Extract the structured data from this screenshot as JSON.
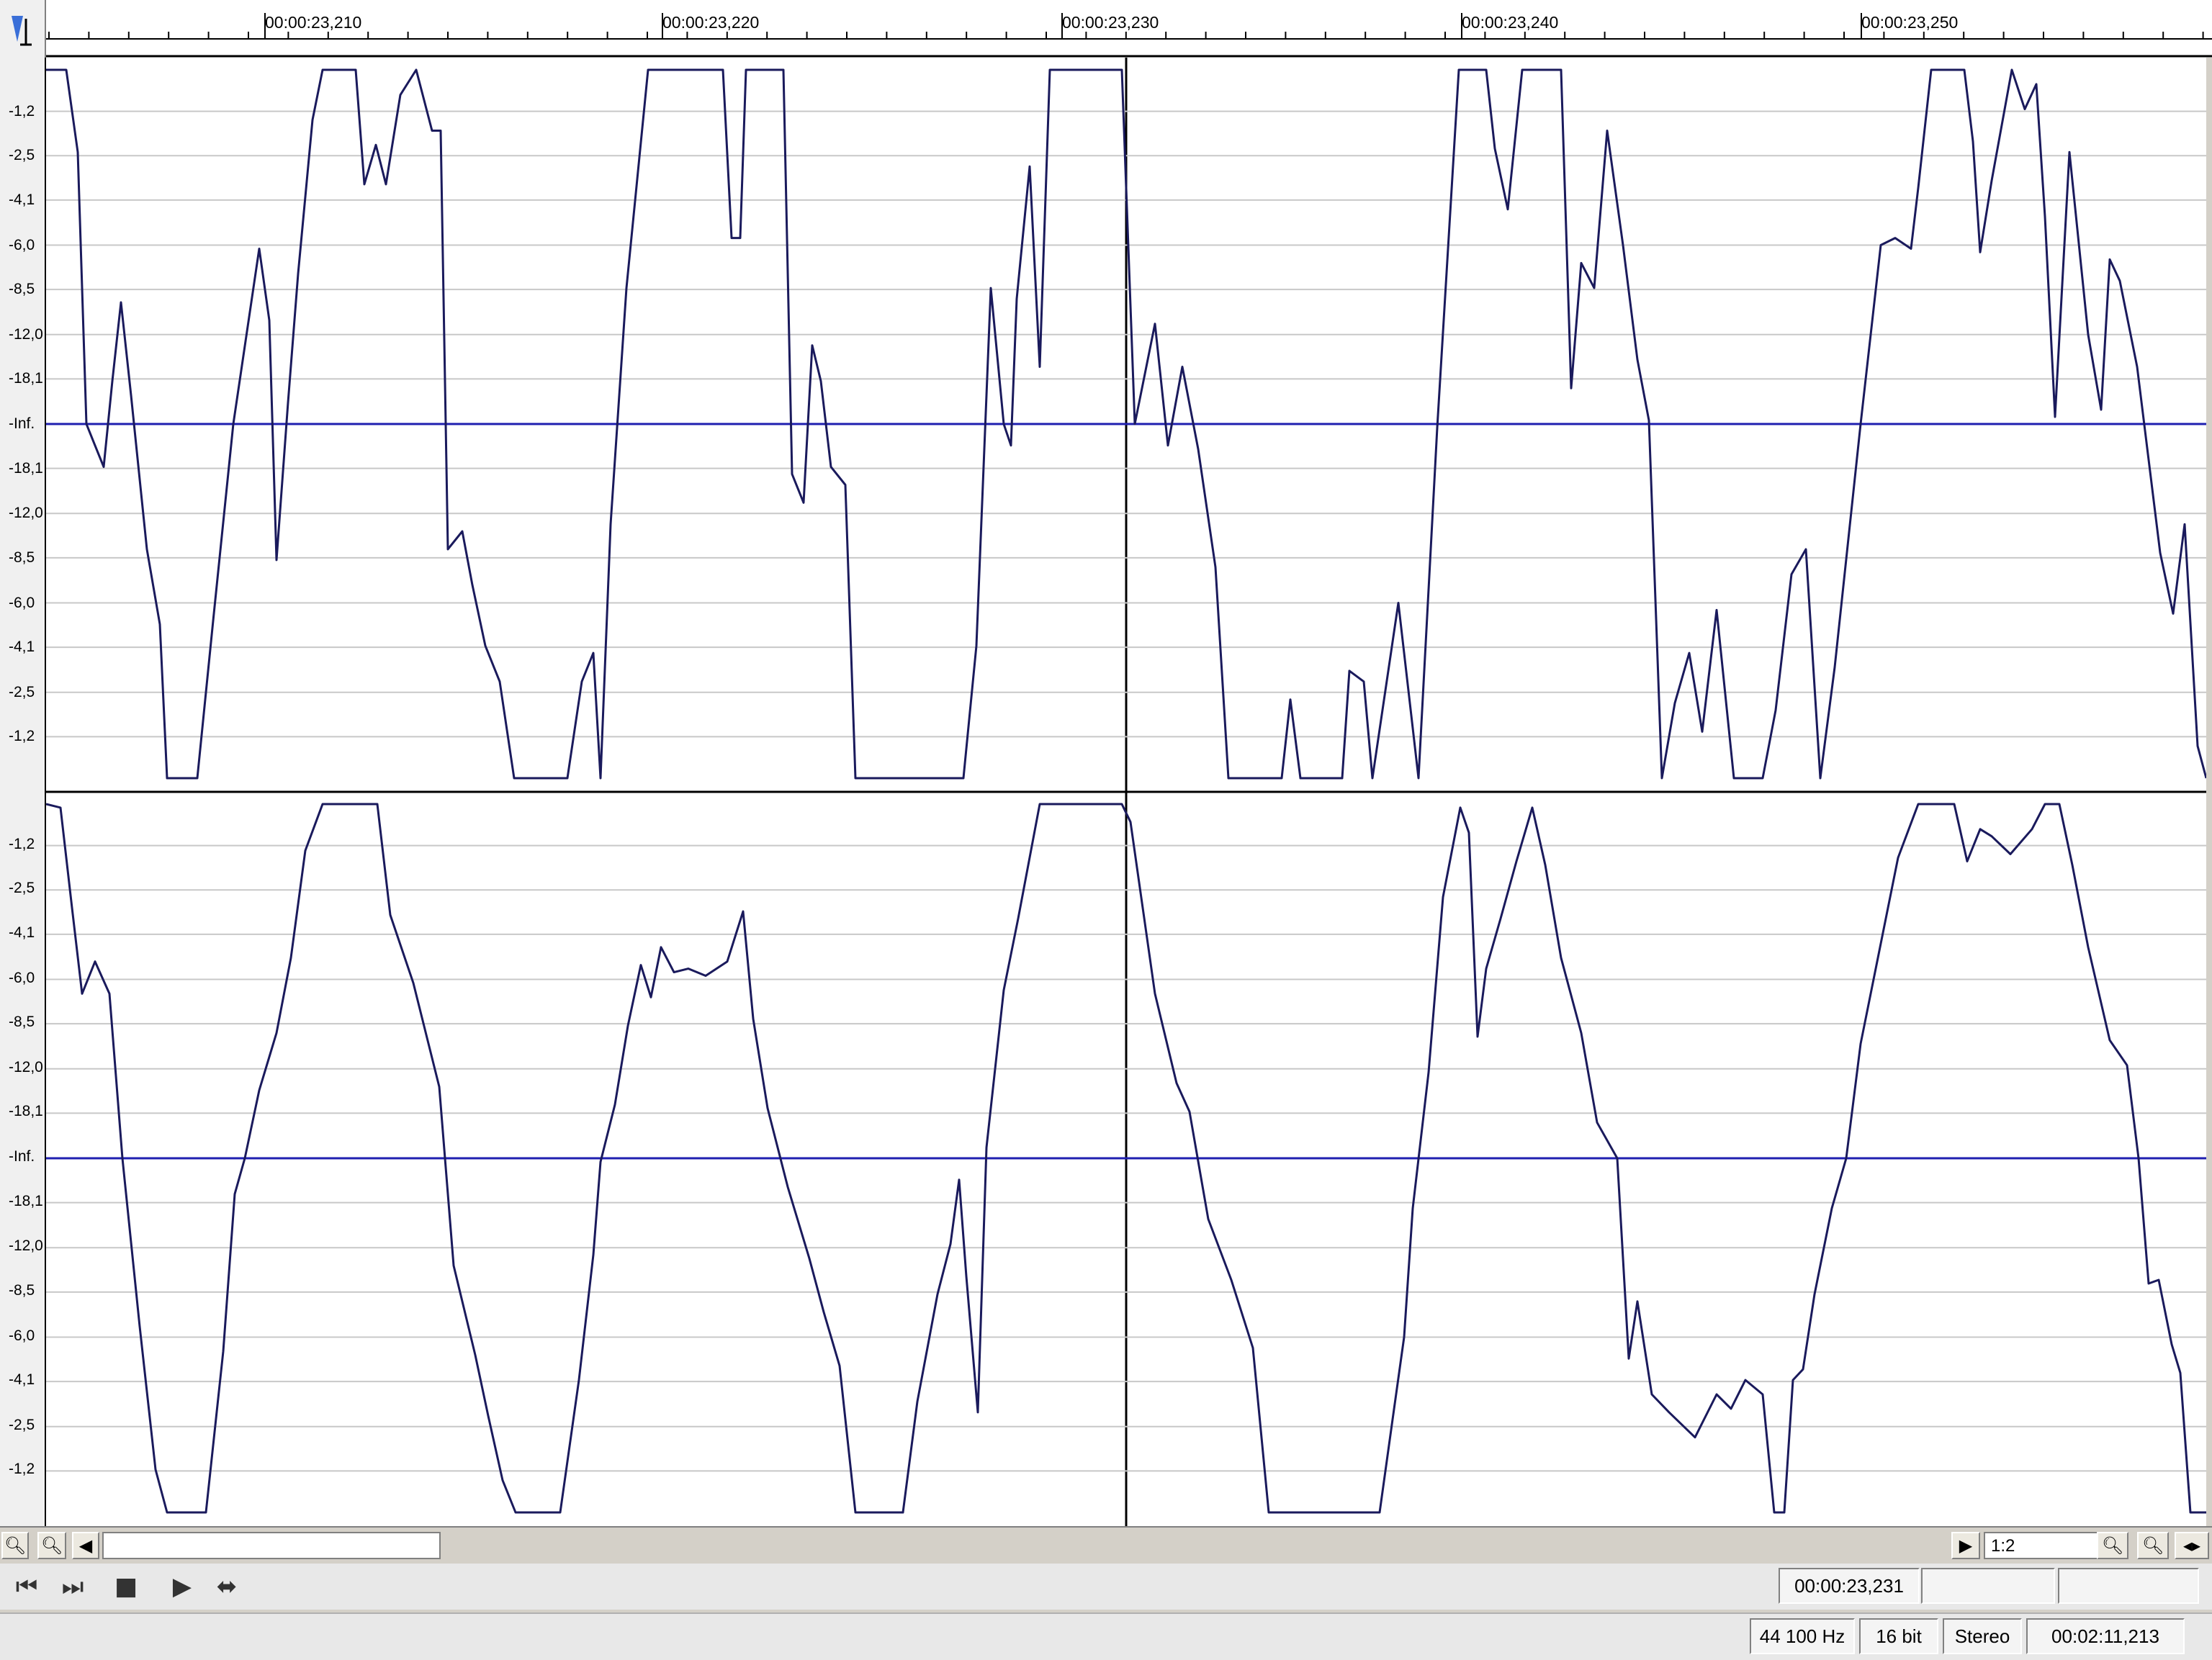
{
  "ruler": {
    "labels": [
      "00:00:23,210",
      "00:00:23,220",
      "00:00:23,230",
      "00:00:23,240",
      "00:00:23,250"
    ]
  },
  "scale": {
    "labels": [
      "-1,2",
      "-2,5",
      "-4,1",
      "-6,0",
      "-8,5",
      "-12,0",
      "-18,1",
      "-Inf.",
      "-18,1",
      "-12,0",
      "-8,5",
      "-6,0",
      "-4,1",
      "-2,5",
      "-1,2"
    ]
  },
  "colors": {
    "waveform": "#1a1a5c",
    "center_line": "#1f1fb0",
    "grid": "#c8c8c8",
    "background": "#ffffff"
  },
  "toolbar": {
    "zoom_ratio": "1:2"
  },
  "transport": {
    "position": "00:00:23,231"
  },
  "status": {
    "sample_rate": "44 100 Hz",
    "bit_depth": "16 bit",
    "channels": "Stereo",
    "duration": "00:02:11,213"
  }
}
